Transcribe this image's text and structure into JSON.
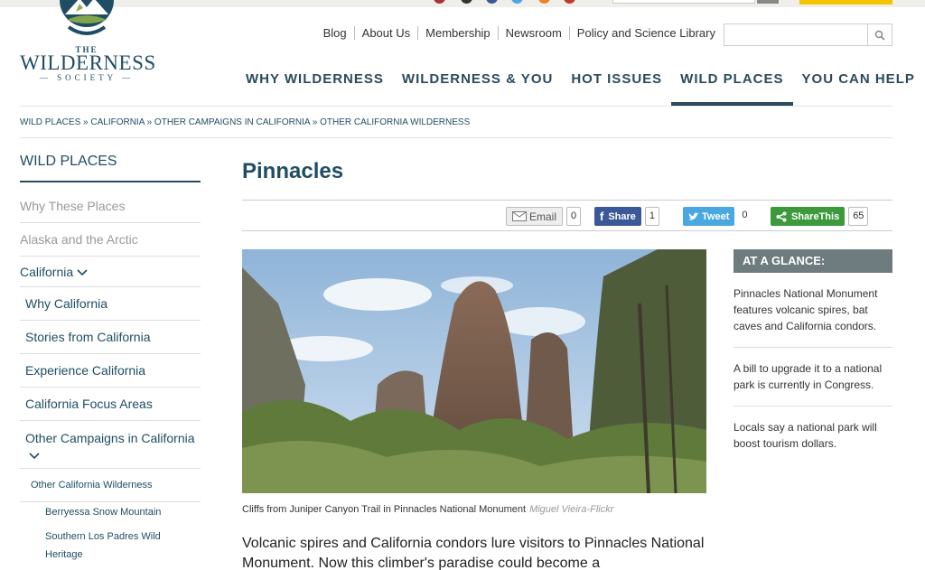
{
  "header": {
    "logo": {
      "the": "THE",
      "name": "WILDERNESS",
      "society": "SOCIETY"
    },
    "util_nav": [
      "Blog",
      "About Us",
      "Membership",
      "Newsroom",
      "Policy and Science Library"
    ],
    "search": {
      "placeholder": ""
    },
    "main_nav": [
      "WHY WILDERNESS",
      "WILDERNESS & YOU",
      "HOT ISSUES",
      "WILD PLACES",
      "YOU CAN HELP"
    ],
    "active_nav": "WILD PLACES"
  },
  "breadcrumb": "WILD PLACES » CALIFORNIA » OTHER CAMPAIGNS IN CALIFORNIA » OTHER CALIFORNIA WILDERNESS",
  "sidebar": {
    "heading": "WILD PLACES",
    "items": [
      "Why These Places",
      "Alaska and the Arctic",
      "California",
      "Why California",
      "Stories from California",
      "Experience California",
      "California Focus Areas",
      "Other Campaigns in California",
      "Other California Wilderness",
      "Berryessa Snow Mountain",
      "Southern Los Padres Wild Heritage"
    ]
  },
  "page": {
    "title": "Pinnacles",
    "share": {
      "email_label": "Email",
      "email_count": "0",
      "facebook_label": "Share",
      "facebook_count": "1",
      "twitter_label": "Tweet",
      "twitter_count": "0",
      "sharethis_label": "ShareThis",
      "sharethis_count": "65"
    },
    "caption": "Cliffs from Juniper Canyon Trail in Pinnacles National Monument",
    "credit": "Miguel Vieira-Flickr",
    "intro": "Volcanic spires and California condors lure visitors to Pinnacles National Monument. Now this climber's paradise could become a"
  },
  "glance": {
    "heading": "AT A GLANCE:",
    "items": [
      "Pinnacles National Monument features volcanic spires, bat caves and California condors.",
      "A bill to upgrade it to a national park is currently in Congress.",
      "Locals say a national park will boost tourism dollars."
    ]
  },
  "colors": {
    "brand": "#1f4d63",
    "nav": "#2b4a5b",
    "facebook": "#3b5998",
    "twitter": "#4aa8e0",
    "sharethis": "#3c9a3c"
  }
}
